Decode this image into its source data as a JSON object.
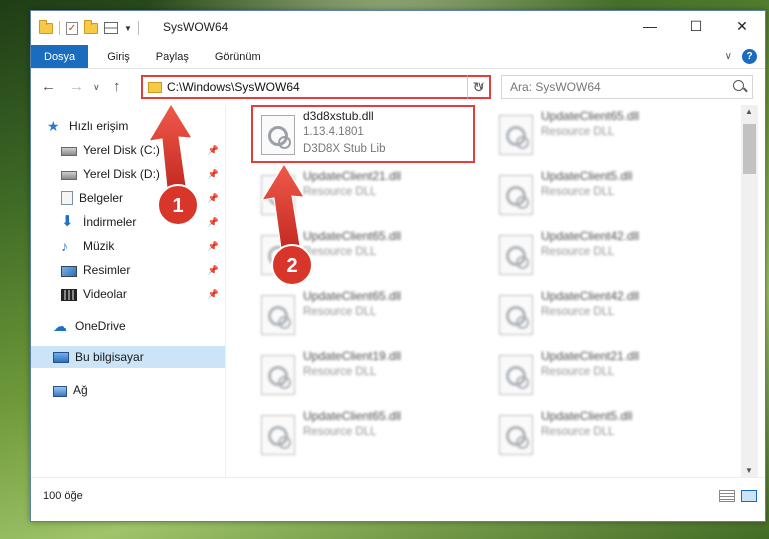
{
  "window": {
    "title": "SysWOW64",
    "minimize_icon": "minimize-icon",
    "maximize_icon": "maximize-icon",
    "close_icon": "close-icon"
  },
  "ribbon": {
    "tabs": [
      "Dosya",
      "Giriş",
      "Paylaş",
      "Görünüm"
    ],
    "active_color": "#1a6cbf"
  },
  "nav": {
    "address": "C:\\Windows\\SysWOW64",
    "search_placeholder": "Ara: SysWOW64"
  },
  "sidebar": {
    "items": [
      {
        "label": "Hızlı erişim",
        "icon": "star-icon"
      },
      {
        "label": "Yerel Disk (C:)",
        "icon": "disk-icon",
        "pinned": true
      },
      {
        "label": "Yerel Disk (D:)",
        "icon": "disk-icon",
        "pinned": true
      },
      {
        "label": "Belgeler",
        "icon": "document-icon",
        "pinned": true
      },
      {
        "label": "İndirmeler",
        "icon": "download-icon",
        "pinned": true
      },
      {
        "label": "Müzik",
        "icon": "music-icon",
        "pinned": true
      },
      {
        "label": "Resimler",
        "icon": "pictures-icon",
        "pinned": true
      },
      {
        "label": "Videolar",
        "icon": "videos-icon",
        "pinned": true
      },
      {
        "label": "OneDrive",
        "icon": "cloud-icon"
      },
      {
        "label": "Bu bilgisayar",
        "icon": "computer-icon",
        "selected": true
      },
      {
        "label": "Ağ",
        "icon": "network-icon"
      }
    ]
  },
  "files": {
    "left": [
      {
        "name": "d3d8xstub.dll",
        "line2": "1.13.4.1801",
        "line3": "D3D8X Stub Lib"
      },
      {
        "name": "UpdateClient21.dll",
        "line2": "Resource DLL"
      },
      {
        "name": "UpdateClient65.dll",
        "line2": "Resource DLL"
      },
      {
        "name": "UpdateClient65.dll",
        "line2": "Resource DLL"
      },
      {
        "name": "UpdateClient19.dll",
        "line2": "Resource DLL"
      },
      {
        "name": "UpdateClient65.dll",
        "line2": "Resource DLL"
      }
    ],
    "right": [
      {
        "name": "UpdateClient65.dll",
        "line2": "Resource DLL"
      },
      {
        "name": "UpdateClient5.dll",
        "line2": "Resource DLL"
      },
      {
        "name": "UpdateClient42.dll",
        "line2": "Resource DLL"
      },
      {
        "name": "UpdateClient42.dll",
        "line2": "Resource DLL"
      },
      {
        "name": "UpdateClient21.dll",
        "line2": "Resource DLL"
      },
      {
        "name": "UpdateClient5.dll",
        "line2": "Resource DLL"
      }
    ]
  },
  "status": {
    "count": "100 öğe"
  },
  "annotations": {
    "badge1": "1",
    "badge2": "2",
    "color": "#e53b3b"
  }
}
